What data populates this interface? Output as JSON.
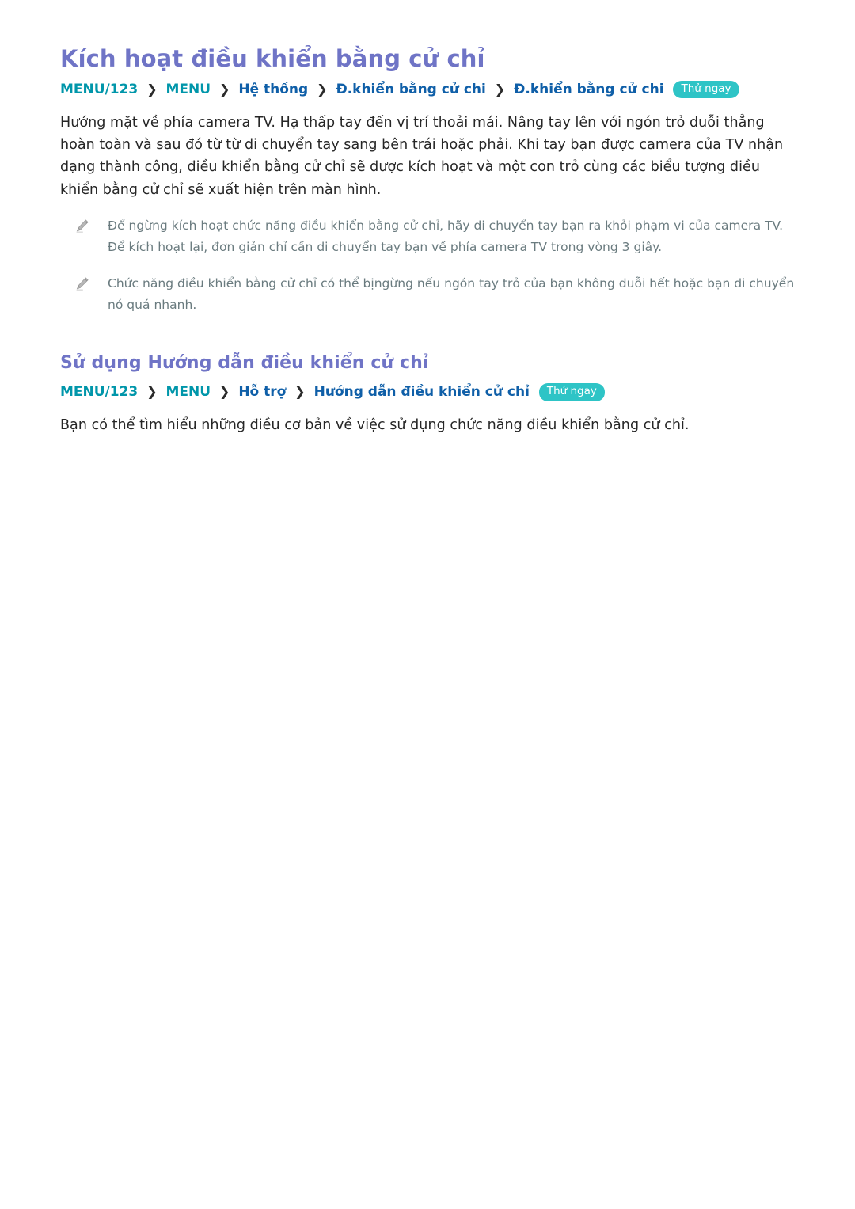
{
  "document": {
    "language": "vi",
    "colors": {
      "heading": "#6f74c6",
      "menu_teal": "#0096aa",
      "menu_path_blue": "#0f5fa8",
      "badge_background": "#2ec4c6",
      "badge_text": "#ffffff",
      "body_text": "#262626",
      "note_text": "#6a7b7f",
      "separator": "#2b2b2b",
      "page_background": "#ffffff"
    }
  },
  "sections": [
    {
      "heading": "Kích hoạt điều khiển bằng cử chỉ",
      "breadcrumb": {
        "segments": [
          {
            "label": "MENU/123",
            "style": "menu"
          },
          {
            "label": "MENU",
            "style": "menu"
          },
          {
            "label": "Hệ thống",
            "style": "path"
          },
          {
            "label": "Đ.khiển bằng cử chi",
            "style": "path"
          },
          {
            "label": "Đ.khiển bằng cử chi",
            "style": "path"
          }
        ],
        "separator": "❯",
        "badge": "Thử ngay"
      },
      "body": "Hướng mặt về phía camera TV. Hạ thấp tay đến vị trí thoải mái. Nâng tay lên với ngón trỏ duỗi thẳng hoàn toàn và sau đó từ từ di chuyển tay sang bên trái hoặc phải. Khi tay bạn được camera của TV nhận dạng thành công, điều khiển bằng cử chỉ sẽ được kích hoạt và một con trỏ cùng các biểu tượng điều khiển bằng cử chỉ sẽ xuất hiện trên màn hình.",
      "notes": [
        {
          "icon": "pencil-icon",
          "text": "Để ngừng kích hoạt chức năng điều khiển bằng cử chỉ, hãy di chuyển tay bạn ra khỏi phạm vi của camera TV. Để kích hoạt lại, đơn giản chỉ cần di chuyển tay bạn về phía camera TV trong vòng 3 giây."
        },
        {
          "icon": "pencil-icon",
          "text": "Chức năng điều khiển bằng cử chỉ có thể bịngừng nếu ngón tay trỏ của bạn không duỗi hết hoặc bạn di chuyển nó quá nhanh."
        }
      ]
    },
    {
      "heading": "Sử dụng Hướng dẫn điều khiển cử chỉ",
      "breadcrumb": {
        "segments": [
          {
            "label": "MENU/123",
            "style": "menu"
          },
          {
            "label": "MENU",
            "style": "menu"
          },
          {
            "label": "Hỗ trợ",
            "style": "path"
          },
          {
            "label": "Hướng dẫn điều khiển cử chỉ",
            "style": "path"
          }
        ],
        "separator": "❯",
        "badge": "Thử ngay"
      },
      "body": "Bạn có thể tìm hiểu những điều cơ bản về việc sử dụng chức năng điều khiển bằng cử chỉ.",
      "notes": []
    }
  ]
}
